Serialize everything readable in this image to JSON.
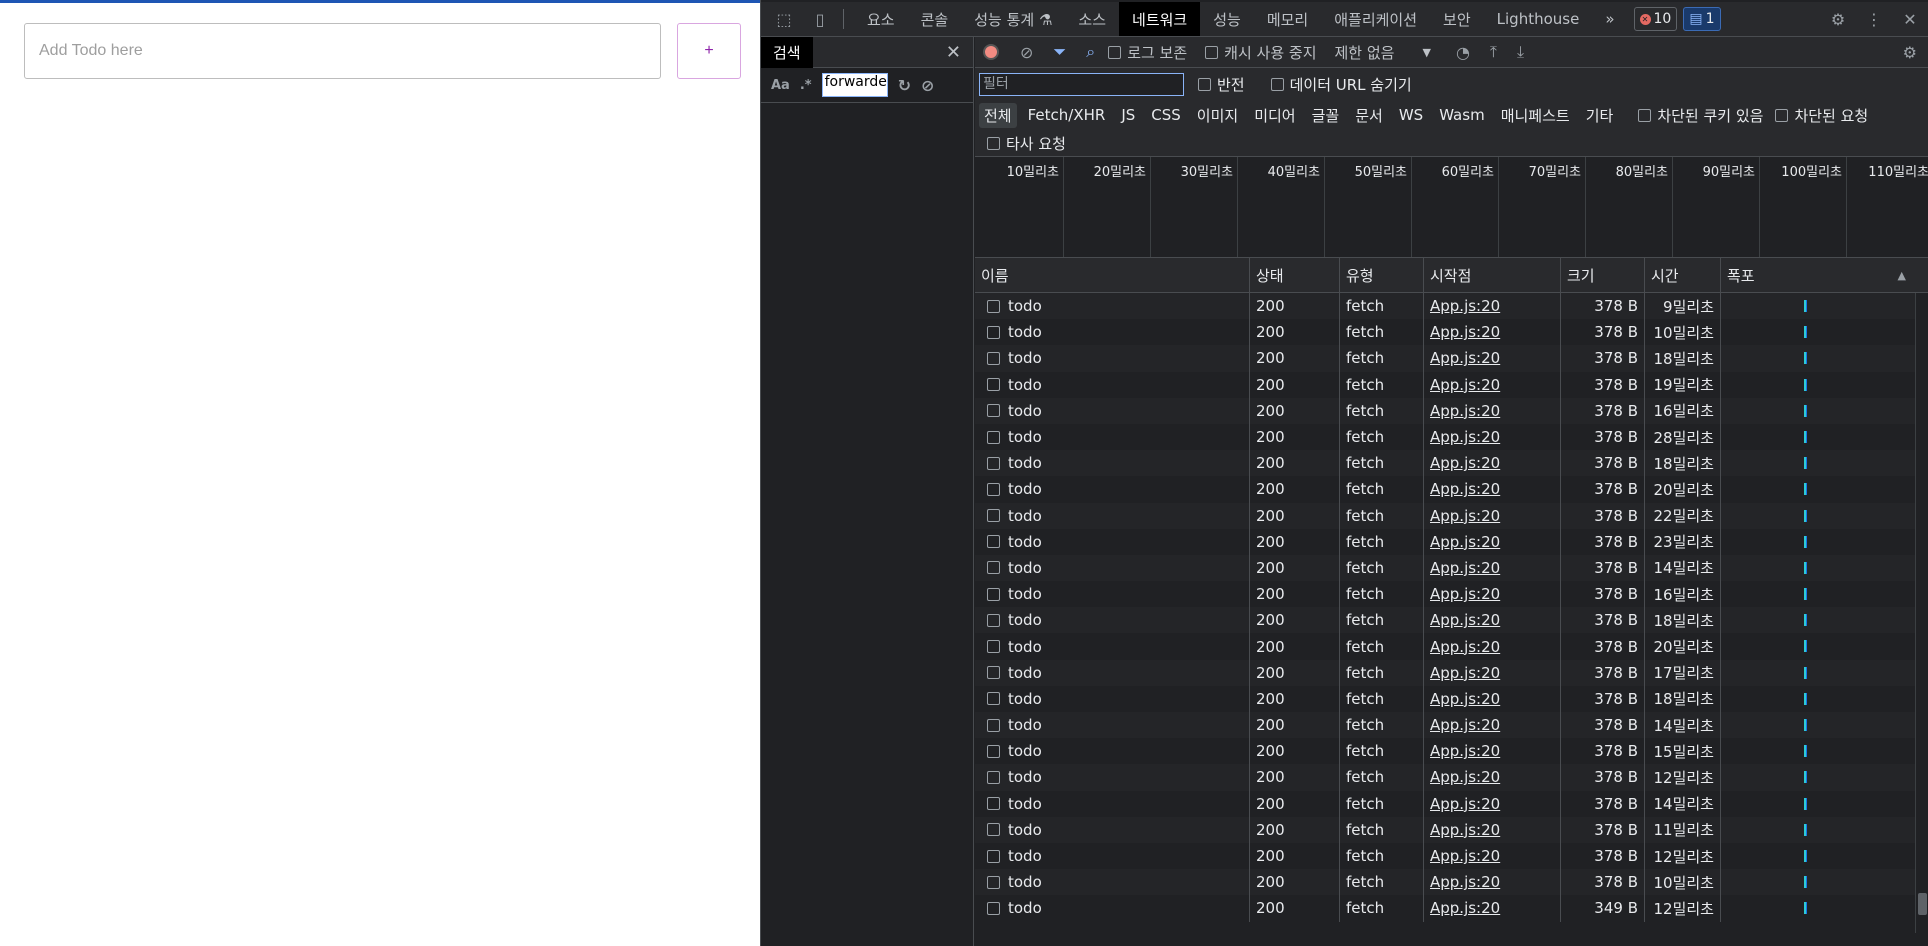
{
  "app": {
    "todo_placeholder": "Add Todo here",
    "add_label": "+"
  },
  "devtools": {
    "tabs": [
      "요소",
      "콘솔",
      "성능 통계 ⚗",
      "소스",
      "네트워크",
      "성능",
      "메모리",
      "애플리케이션",
      "보안",
      "Lighthouse"
    ],
    "active_tab": "네트워크",
    "more_tabs": "»",
    "error_count": "10",
    "message_count": "1",
    "search_pane": {
      "title": "검색",
      "match_case": "Aa",
      "regex": ".*",
      "query": "forwarde"
    },
    "toolbar": {
      "preserve_log": "로그 보존",
      "disable_cache": "캐시 사용 중지",
      "throttle": "제한 없음"
    },
    "filter": {
      "placeholder": "필터",
      "invert": "반전",
      "hide_data_urls": "데이터 URL 숨기기"
    },
    "types": [
      "전체",
      "Fetch/XHR",
      "JS",
      "CSS",
      "이미지",
      "미디어",
      "글꼴",
      "문서",
      "WS",
      "Wasm",
      "매니페스트",
      "기타"
    ],
    "blocked_cookies": "차단된 쿠키 있음",
    "blocked_requests": "차단된 요청",
    "third_party": "타사 요청",
    "overview_ticks": [
      "10밀리초",
      "20밀리초",
      "30밀리초",
      "40밀리초",
      "50밀리초",
      "60밀리초",
      "70밀리초",
      "80밀리초",
      "90밀리초",
      "100밀리초",
      "110밀리초"
    ],
    "columns": {
      "name": "이름",
      "status": "상태",
      "type": "유형",
      "initiator": "시작점",
      "size": "크기",
      "time": "시간",
      "waterfall": "폭포"
    },
    "requests": [
      {
        "name": "todo",
        "status": "200",
        "type": "fetch",
        "initiator": "App.js:20",
        "size": "378 B",
        "time": "9밀리초"
      },
      {
        "name": "todo",
        "status": "200",
        "type": "fetch",
        "initiator": "App.js:20",
        "size": "378 B",
        "time": "10밀리초"
      },
      {
        "name": "todo",
        "status": "200",
        "type": "fetch",
        "initiator": "App.js:20",
        "size": "378 B",
        "time": "18밀리초"
      },
      {
        "name": "todo",
        "status": "200",
        "type": "fetch",
        "initiator": "App.js:20",
        "size": "378 B",
        "time": "19밀리초"
      },
      {
        "name": "todo",
        "status": "200",
        "type": "fetch",
        "initiator": "App.js:20",
        "size": "378 B",
        "time": "16밀리초"
      },
      {
        "name": "todo",
        "status": "200",
        "type": "fetch",
        "initiator": "App.js:20",
        "size": "378 B",
        "time": "28밀리초"
      },
      {
        "name": "todo",
        "status": "200",
        "type": "fetch",
        "initiator": "App.js:20",
        "size": "378 B",
        "time": "18밀리초"
      },
      {
        "name": "todo",
        "status": "200",
        "type": "fetch",
        "initiator": "App.js:20",
        "size": "378 B",
        "time": "20밀리초"
      },
      {
        "name": "todo",
        "status": "200",
        "type": "fetch",
        "initiator": "App.js:20",
        "size": "378 B",
        "time": "22밀리초"
      },
      {
        "name": "todo",
        "status": "200",
        "type": "fetch",
        "initiator": "App.js:20",
        "size": "378 B",
        "time": "23밀리초"
      },
      {
        "name": "todo",
        "status": "200",
        "type": "fetch",
        "initiator": "App.js:20",
        "size": "378 B",
        "time": "14밀리초"
      },
      {
        "name": "todo",
        "status": "200",
        "type": "fetch",
        "initiator": "App.js:20",
        "size": "378 B",
        "time": "16밀리초"
      },
      {
        "name": "todo",
        "status": "200",
        "type": "fetch",
        "initiator": "App.js:20",
        "size": "378 B",
        "time": "18밀리초"
      },
      {
        "name": "todo",
        "status": "200",
        "type": "fetch",
        "initiator": "App.js:20",
        "size": "378 B",
        "time": "20밀리초"
      },
      {
        "name": "todo",
        "status": "200",
        "type": "fetch",
        "initiator": "App.js:20",
        "size": "378 B",
        "time": "17밀리초"
      },
      {
        "name": "todo",
        "status": "200",
        "type": "fetch",
        "initiator": "App.js:20",
        "size": "378 B",
        "time": "18밀리초"
      },
      {
        "name": "todo",
        "status": "200",
        "type": "fetch",
        "initiator": "App.js:20",
        "size": "378 B",
        "time": "14밀리초"
      },
      {
        "name": "todo",
        "status": "200",
        "type": "fetch",
        "initiator": "App.js:20",
        "size": "378 B",
        "time": "15밀리초"
      },
      {
        "name": "todo",
        "status": "200",
        "type": "fetch",
        "initiator": "App.js:20",
        "size": "378 B",
        "time": "12밀리초"
      },
      {
        "name": "todo",
        "status": "200",
        "type": "fetch",
        "initiator": "App.js:20",
        "size": "378 B",
        "time": "14밀리초"
      },
      {
        "name": "todo",
        "status": "200",
        "type": "fetch",
        "initiator": "App.js:20",
        "size": "378 B",
        "time": "11밀리초"
      },
      {
        "name": "todo",
        "status": "200",
        "type": "fetch",
        "initiator": "App.js:20",
        "size": "378 B",
        "time": "12밀리초"
      },
      {
        "name": "todo",
        "status": "200",
        "type": "fetch",
        "initiator": "App.js:20",
        "size": "378 B",
        "time": "10밀리초"
      },
      {
        "name": "todo",
        "status": "200",
        "type": "fetch",
        "initiator": "App.js:20",
        "size": "349 B",
        "time": "12밀리초"
      }
    ],
    "colors": {
      "background": "#202124",
      "record": "#f28b82",
      "accent": "#8ab4f8",
      "waterfall": "#1a73e8"
    }
  }
}
